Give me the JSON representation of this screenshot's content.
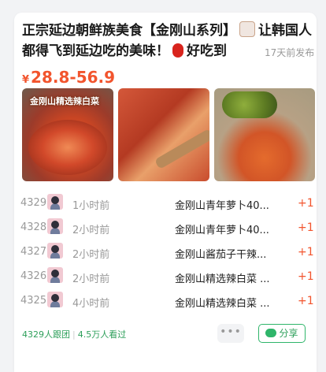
{
  "card": {
    "title": "正宗延边朝鲜族美食【金刚山系列】",
    "title_tail": "让韩国人都得飞到延边吃的美味！",
    "title_tail2": "好吃到",
    "time_ago": "17天前发布",
    "price_symbol": "¥",
    "price": "28.8-56.9",
    "image1_label": "金刚山精选辣白菜"
  },
  "records": [
    {
      "num": "4329",
      "ago": "1小时前",
      "item": "金刚山青年萝卜40...",
      "plus": "+1"
    },
    {
      "num": "4328",
      "ago": "2小时前",
      "item": "金刚山青年萝卜40...",
      "plus": "+1"
    },
    {
      "num": "4327",
      "ago": "2小时前",
      "item": "金刚山酱茄子干辣...",
      "plus": "+1"
    },
    {
      "num": "4326",
      "ago": "2小时前",
      "item": "金刚山精选辣白菜 ...",
      "plus": "+1"
    },
    {
      "num": "4325",
      "ago": "4小时前",
      "item": "金刚山精选辣白菜 ...",
      "plus": "+1"
    }
  ],
  "footer": {
    "followers": "4329人跟团",
    "views": "4.5万人看过",
    "more": "•••",
    "share": "分享"
  },
  "colors": {
    "price": "#f2542d",
    "green": "#2d9f5a",
    "background": "#f2f3f5"
  }
}
